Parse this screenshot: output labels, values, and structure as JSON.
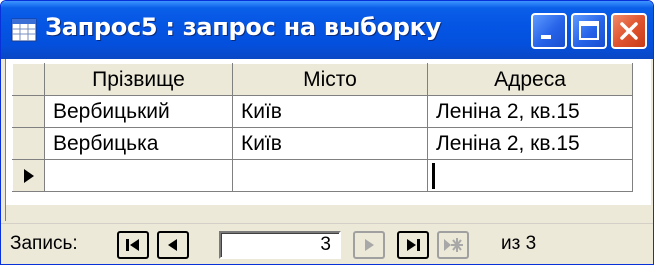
{
  "window": {
    "title": "Запрос5 : запрос на выборку",
    "icon": "query-datasheet-icon",
    "controls": [
      "minimize-icon",
      "maximize-icon",
      "close-icon"
    ],
    "accent": "#0554e3",
    "close_color": "#e0552f"
  },
  "grid": {
    "columns": [
      "Прізвище",
      "Місто",
      "Адреса"
    ],
    "rows": [
      [
        "Вербицький",
        "Київ",
        "Леніна 2, кв.15"
      ],
      [
        "Вербицька",
        "Київ",
        "Леніна 2, кв.15"
      ]
    ],
    "new_row_indicator": "current-record-pointer-icon"
  },
  "navigation": {
    "record_label": "Запись:",
    "current_record": "3",
    "total_text": "из 3",
    "buttons": [
      "first-record-icon",
      "previous-record-icon",
      "next-record-icon",
      "last-record-icon",
      "new-record-icon"
    ]
  }
}
